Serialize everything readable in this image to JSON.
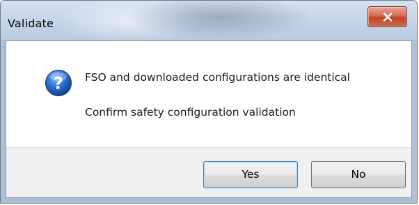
{
  "window": {
    "title": "Validate"
  },
  "dialog": {
    "icon": "question-icon",
    "message_line1": "FSO and downloaded configurations are identical",
    "message_line2": "Confirm safety configuration validation"
  },
  "buttons": {
    "yes_label": "Yes",
    "no_label": "No"
  },
  "colors": {
    "close_button": "#c0412a",
    "question_icon": "#1f5fbf",
    "default_button_border": "#3c7fb1"
  }
}
